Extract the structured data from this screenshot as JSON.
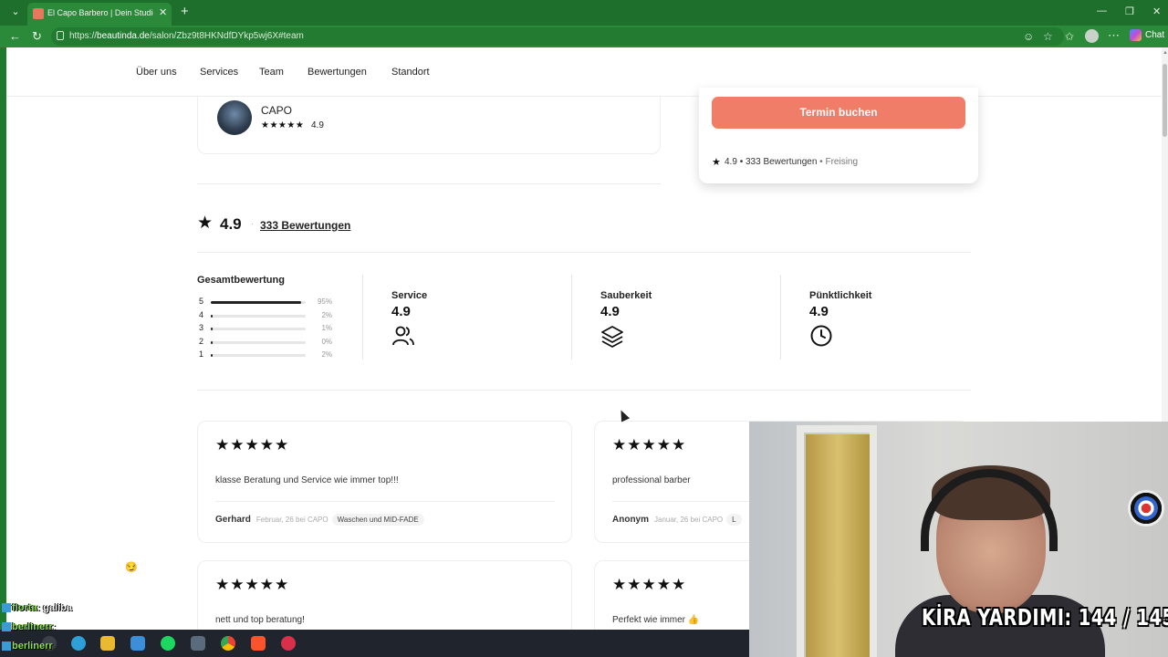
{
  "browser": {
    "tab_title": "El Capo Barbero | Dein Studio in Freising",
    "url_prefix": "https://",
    "url_domain": "beautinda.de",
    "url_path": "/salon/Zbz9t8HKNdfDYkp5wj6X#team",
    "chat_label": "Chat"
  },
  "nav": {
    "items": [
      "Über uns",
      "Services",
      "Team",
      "Bewertungen",
      "Standort"
    ]
  },
  "barber": {
    "name": "CAPO",
    "stars": "★★★★★",
    "rating": "4.9"
  },
  "booking": {
    "button_label": "Termin buchen",
    "rating": "4.9",
    "reviews": "333 Bewertungen",
    "location": "Freising",
    "separator": "•"
  },
  "ratings": {
    "average": "4.9",
    "count_label": "333 Bewertungen",
    "overall_title": "Gesamtbewertung",
    "distribution": [
      {
        "stars": "5",
        "fraction": 0.95,
        "pct": "95%"
      },
      {
        "stars": "4",
        "fraction": 0.02,
        "pct": "2%"
      },
      {
        "stars": "3",
        "fraction": 0.01,
        "pct": "1%"
      },
      {
        "stars": "2",
        "fraction": 0.0,
        "pct": "0%"
      },
      {
        "stars": "1",
        "fraction": 0.02,
        "pct": "2%"
      }
    ],
    "categories": [
      {
        "title": "Service",
        "value": "4.9",
        "icon": "people-icon"
      },
      {
        "title": "Sauberkeit",
        "value": "4.9",
        "icon": "layers-icon"
      },
      {
        "title": "Pünktlichkeit",
        "value": "4.9",
        "icon": "clock-icon"
      }
    ]
  },
  "reviews": [
    {
      "stars": "★★★★★",
      "text": "klasse Beratung und Service wie immer top!!!",
      "author": "Gerhard",
      "date": "Februar, 26 bei CAPO",
      "tag": "Waschen und MID-FADE"
    },
    {
      "stars": "★★★★★",
      "text": "professional barber",
      "author": "Anonym",
      "date": "Januar, 26 bei CAPO",
      "tag": "L"
    },
    {
      "stars": "★★★★★",
      "text": "nett und top beratung!"
    },
    {
      "stars": "★★★★★",
      "text": "Perfekt wie immer 👍"
    }
  ],
  "stream": {
    "chat": [
      {
        "name": "florta",
        "msg": ": galiba"
      },
      {
        "name": "berlinerr",
        "msg": ": "
      },
      {
        "name": "berlinerr",
        "msg": ""
      }
    ],
    "counter": "KİRA YARDIMI:  144 / 145"
  }
}
